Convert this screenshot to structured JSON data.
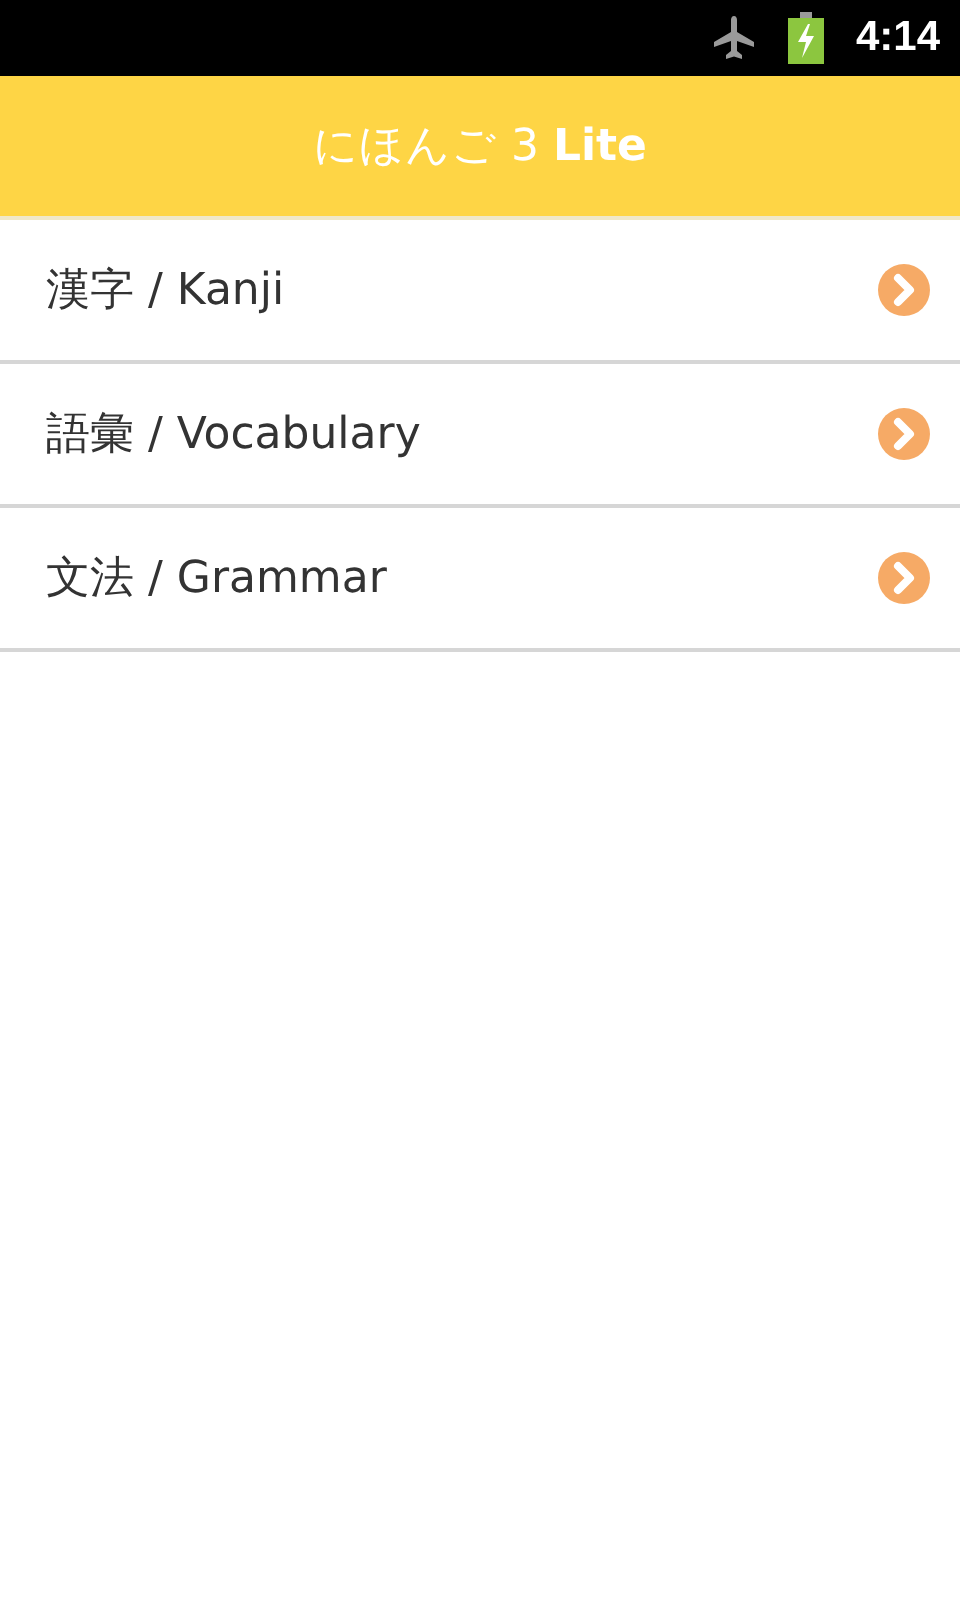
{
  "status_bar": {
    "time": "4:14"
  },
  "header": {
    "title": "にほんご 3 **Lite**"
  },
  "menu": [
    {
      "label": "漢字 / Kanji"
    },
    {
      "label": "語彙 / Vocabulary"
    },
    {
      "label": "文法 / Grammar"
    }
  ]
}
